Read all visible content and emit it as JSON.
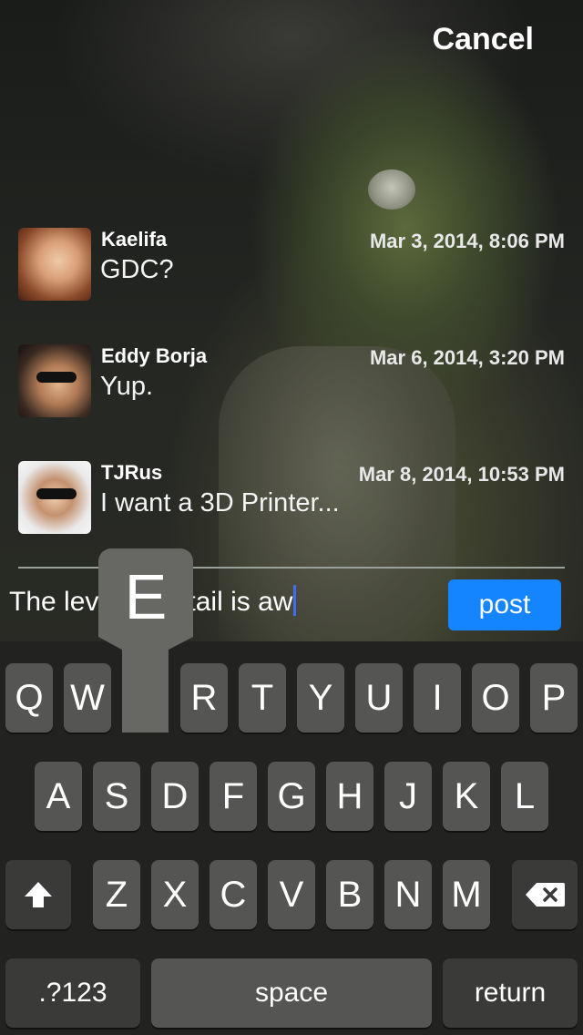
{
  "header": {
    "cancel_label": "Cancel"
  },
  "messages": [
    {
      "name": "Kaelifa",
      "time": "Mar 3, 2014, 8:06 PM",
      "text": "GDC?"
    },
    {
      "name": "Eddy Borja",
      "time": "Mar 6, 2014, 3:20 PM",
      "text": "Yup."
    },
    {
      "name": "TJRus",
      "time": "Mar 8, 2014, 10:53 PM",
      "text": "I want a 3D Printer..."
    }
  ],
  "composer": {
    "text_left": "The lev",
    "text_right": "tail is aw",
    "post_label": "post"
  },
  "keyboard": {
    "row1": [
      "Q",
      "W",
      "E",
      "R",
      "T",
      "Y",
      "U",
      "I",
      "O",
      "P"
    ],
    "row2": [
      "A",
      "S",
      "D",
      "F",
      "G",
      "H",
      "J",
      "K",
      "L"
    ],
    "row3": [
      "Z",
      "X",
      "C",
      "V",
      "B",
      "N",
      "M"
    ],
    "numbers_label": ".?123",
    "space_label": "space",
    "return_label": "return",
    "pressed_key": "E",
    "shift_icon": "shift-icon",
    "delete_icon": "delete-icon"
  },
  "colors": {
    "accent": "#1484ff",
    "caret": "#3f6cf0"
  }
}
